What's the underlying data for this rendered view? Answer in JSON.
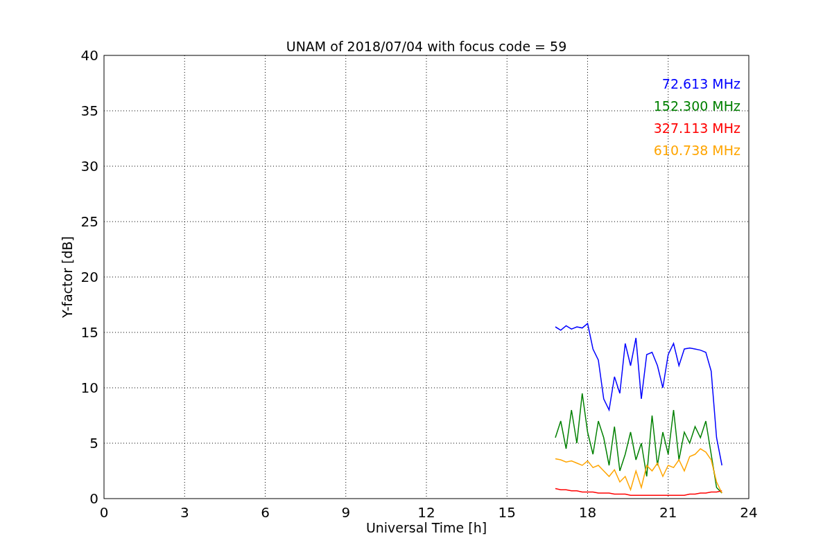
{
  "figure": {
    "chart_data": {
      "type": "line",
      "title": "UNAM of 2018/07/04 with focus code = 59",
      "xlabel": "Universal Time [h]",
      "ylabel": "Y-factor [dB]",
      "xlim": [
        0,
        24
      ],
      "ylim": [
        0,
        40
      ],
      "xticks": [
        0,
        3,
        6,
        9,
        12,
        15,
        18,
        21,
        24
      ],
      "yticks": [
        0,
        5,
        10,
        15,
        20,
        25,
        30,
        35,
        40
      ],
      "grid": true,
      "x": [
        16.8,
        17.0,
        17.2,
        17.4,
        17.6,
        17.8,
        18.0,
        18.2,
        18.4,
        18.6,
        18.8,
        19.0,
        19.2,
        19.4,
        19.6,
        19.8,
        20.0,
        20.2,
        20.4,
        20.6,
        20.8,
        21.0,
        21.2,
        21.4,
        21.6,
        21.8,
        22.0,
        22.2,
        22.4,
        22.6,
        22.8,
        23.0
      ],
      "series": [
        {
          "name": "72.613 MHz",
          "color": "#0000ff",
          "values": [
            15.5,
            15.2,
            15.6,
            15.3,
            15.5,
            15.4,
            15.8,
            13.5,
            12.5,
            9.0,
            8.0,
            11.0,
            9.5,
            14.0,
            12.0,
            14.5,
            9.0,
            13.0,
            13.2,
            12.0,
            10.0,
            13.0,
            14.0,
            12.0,
            13.5,
            13.6,
            13.5,
            13.4,
            13.2,
            11.5,
            5.5,
            3.0
          ]
        },
        {
          "name": "152.300 MHz",
          "color": "#008000",
          "values": [
            5.5,
            7.0,
            4.5,
            8.0,
            5.0,
            9.5,
            6.0,
            4.0,
            7.0,
            5.5,
            3.0,
            6.5,
            2.5,
            4.0,
            6.0,
            3.5,
            5.0,
            2.0,
            7.5,
            3.0,
            6.0,
            4.0,
            8.0,
            3.5,
            6.0,
            5.0,
            6.5,
            5.5,
            7.0,
            4.0,
            1.0,
            0.5
          ]
        },
        {
          "name": "327.113 MHz",
          "color": "#ff0000",
          "values": [
            0.9,
            0.8,
            0.8,
            0.7,
            0.7,
            0.6,
            0.6,
            0.6,
            0.5,
            0.5,
            0.5,
            0.4,
            0.4,
            0.4,
            0.3,
            0.3,
            0.3,
            0.3,
            0.3,
            0.3,
            0.3,
            0.3,
            0.3,
            0.3,
            0.3,
            0.4,
            0.4,
            0.5,
            0.5,
            0.6,
            0.6,
            0.7
          ]
        },
        {
          "name": "610.738 MHz",
          "color": "#ffa500",
          "values": [
            3.6,
            3.5,
            3.3,
            3.4,
            3.2,
            3.0,
            3.4,
            2.8,
            3.0,
            2.5,
            2.0,
            2.6,
            1.5,
            2.0,
            0.8,
            2.5,
            1.0,
            3.0,
            2.5,
            3.2,
            2.0,
            3.0,
            2.8,
            3.5,
            2.5,
            3.8,
            4.0,
            4.5,
            4.2,
            3.5,
            1.5,
            0.5
          ]
        }
      ]
    }
  }
}
